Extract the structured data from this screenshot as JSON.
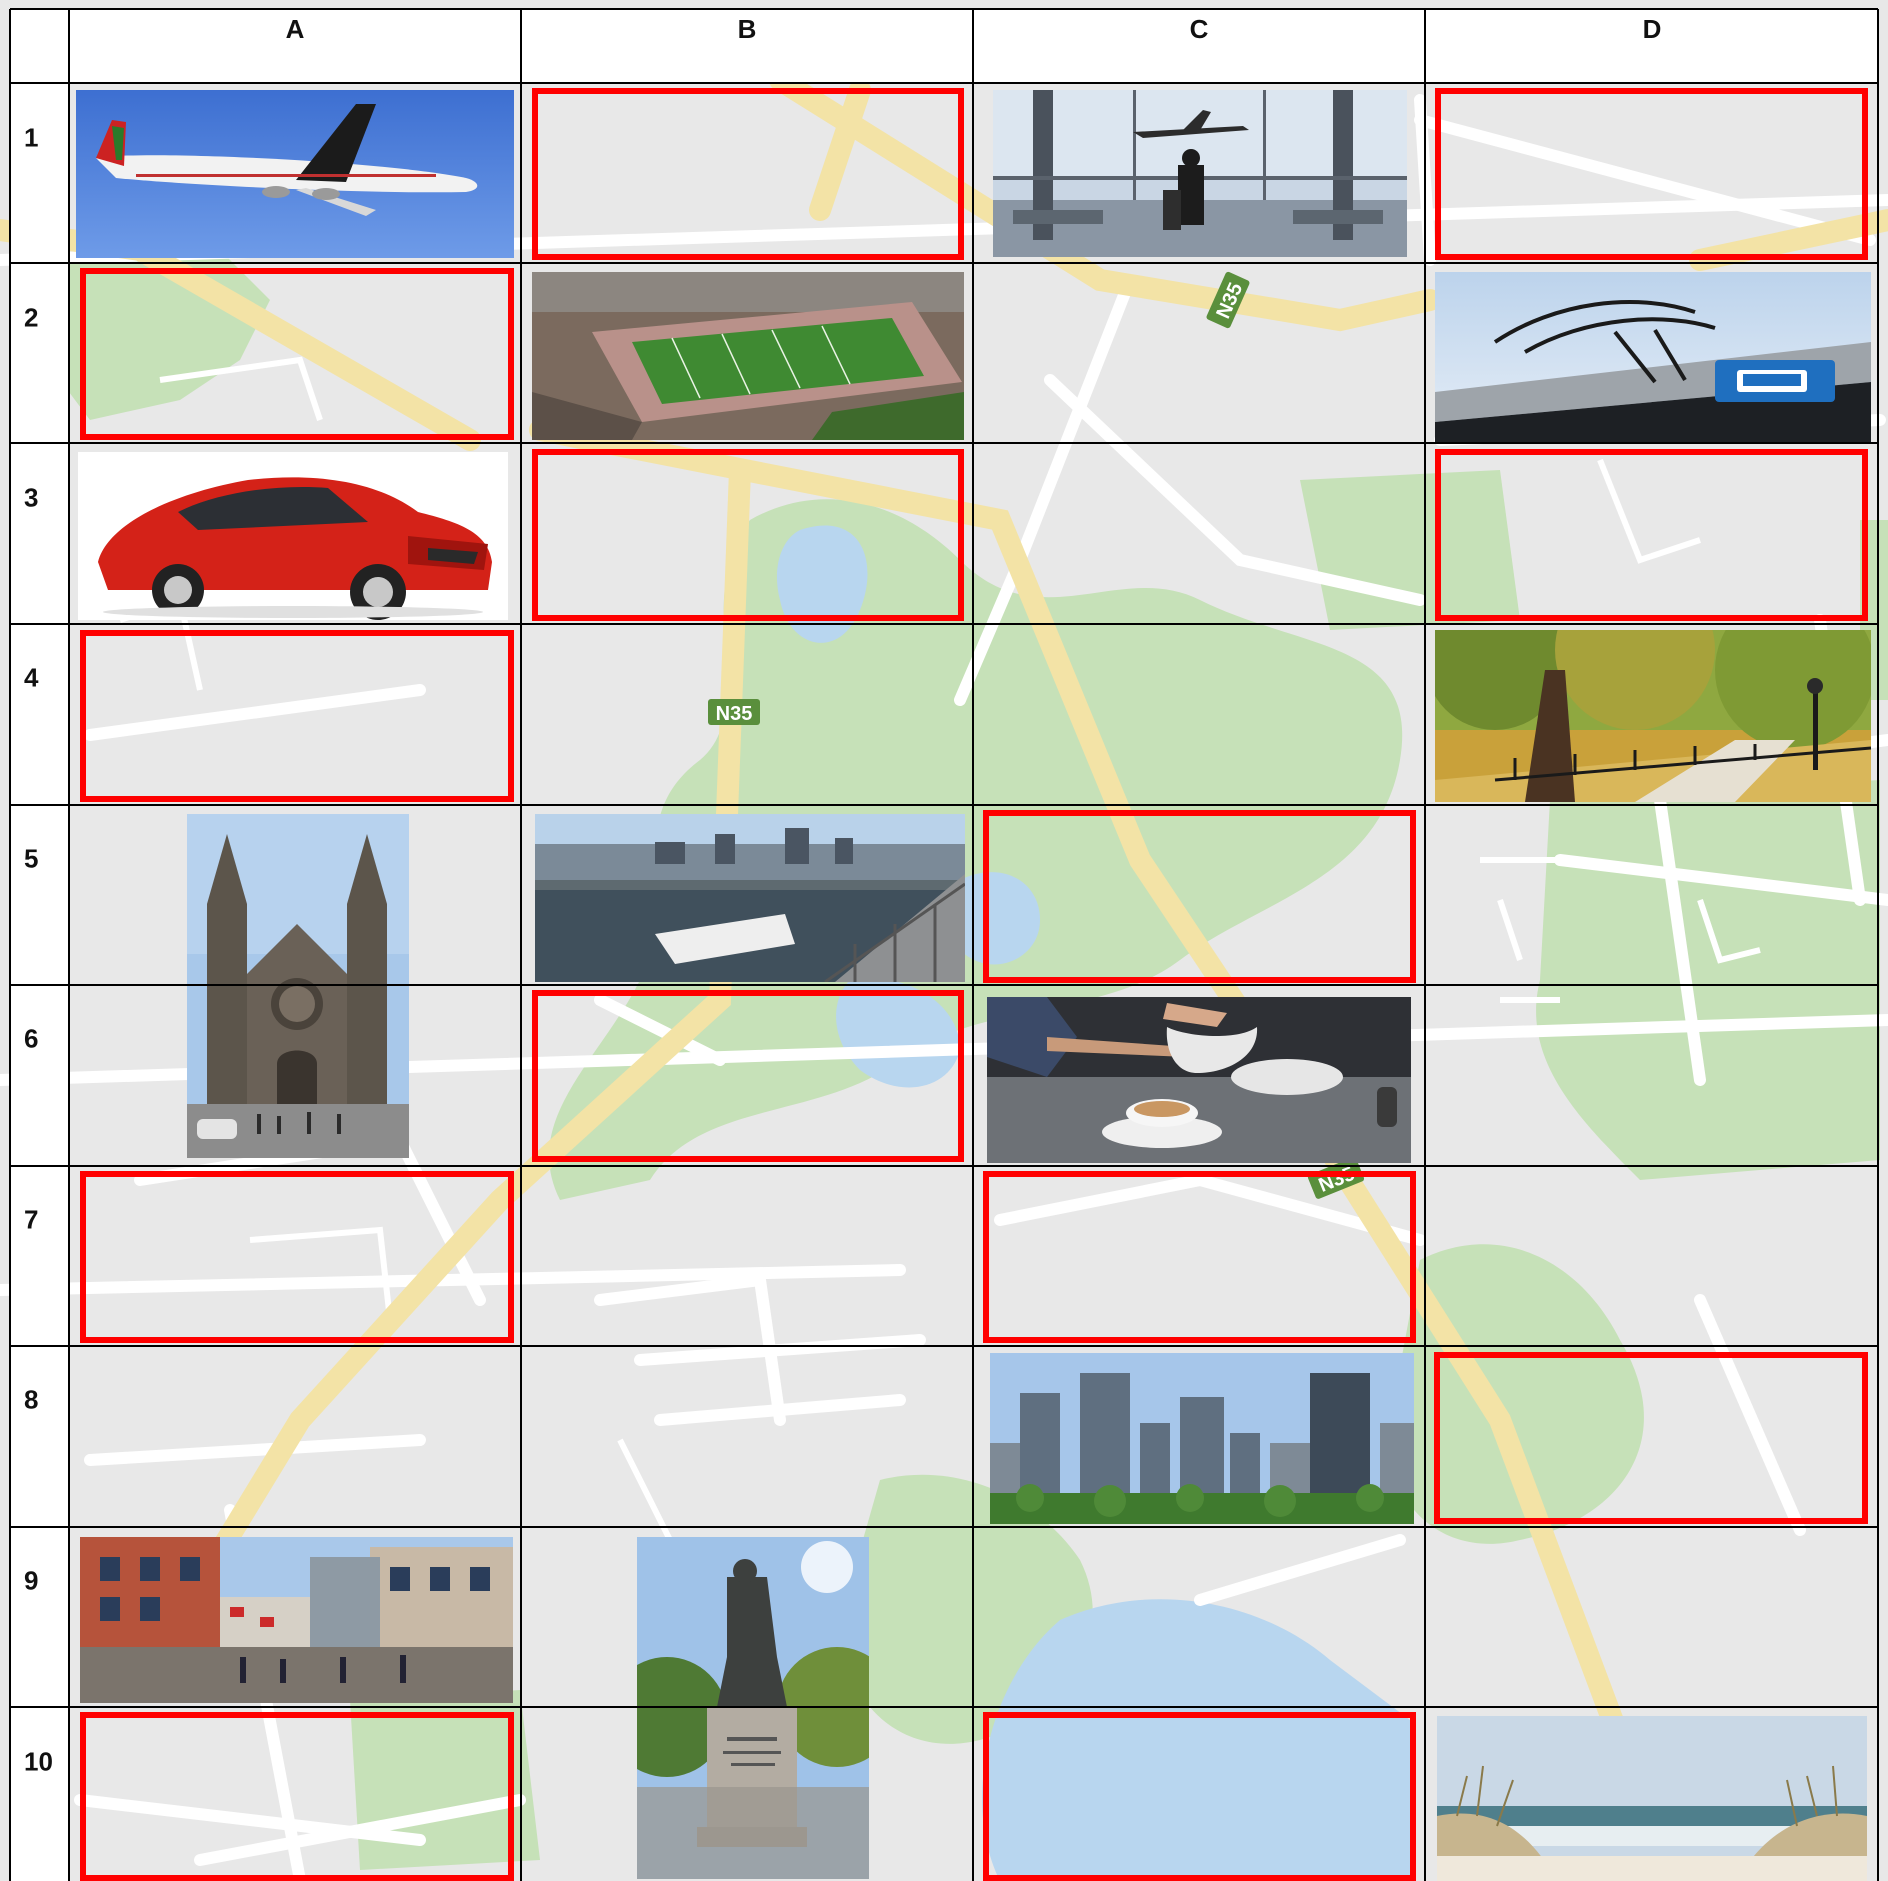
{
  "columns": [
    "A",
    "B",
    "C",
    "D"
  ],
  "rows": [
    "1",
    "2",
    "3",
    "4",
    "5",
    "6",
    "7",
    "8",
    "9",
    "10"
  ],
  "road_labels": [
    "N35",
    "N35",
    "N35"
  ],
  "colors": {
    "map_background": "#e8e8e8",
    "map_roads": "#ffffff",
    "map_highway": "#f3e3a6",
    "map_park": "#c6e1b8",
    "map_water": "#b8d6ef",
    "highway_shield": "#5a8f3c",
    "blank_border": "#ff0000",
    "grid_lines": "#000000"
  },
  "cells": [
    {
      "ref": "A1",
      "content": "photo",
      "icon": "airplane-photo"
    },
    {
      "ref": "B1",
      "content": "blank"
    },
    {
      "ref": "C1",
      "content": "photo",
      "icon": "airport-traveler-photo"
    },
    {
      "ref": "D1",
      "content": "blank"
    },
    {
      "ref": "A2",
      "content": "blank"
    },
    {
      "ref": "B2",
      "content": "photo",
      "icon": "stadium-photo"
    },
    {
      "ref": "C2",
      "content": "empty"
    },
    {
      "ref": "D2",
      "content": "photo",
      "icon": "tram-stop-photo"
    },
    {
      "ref": "A3",
      "content": "photo",
      "icon": "red-car-photo"
    },
    {
      "ref": "B3",
      "content": "blank"
    },
    {
      "ref": "C3",
      "content": "empty"
    },
    {
      "ref": "D3",
      "content": "blank"
    },
    {
      "ref": "A4",
      "content": "blank"
    },
    {
      "ref": "B4",
      "content": "empty"
    },
    {
      "ref": "C4",
      "content": "empty"
    },
    {
      "ref": "D4",
      "content": "photo",
      "icon": "autumn-park-photo"
    },
    {
      "ref": "A5",
      "content": "photo",
      "icon": "cathedral-photo"
    },
    {
      "ref": "B5",
      "content": "photo",
      "icon": "harbour-photo"
    },
    {
      "ref": "C5",
      "content": "blank"
    },
    {
      "ref": "D5",
      "content": "empty"
    },
    {
      "ref": "A6",
      "content": "photo",
      "icon": "cathedral-photo"
    },
    {
      "ref": "B6",
      "content": "blank"
    },
    {
      "ref": "C6",
      "content": "photo",
      "icon": "coffee-photo"
    },
    {
      "ref": "D6",
      "content": "empty"
    },
    {
      "ref": "A7",
      "content": "blank"
    },
    {
      "ref": "B7",
      "content": "empty"
    },
    {
      "ref": "C7",
      "content": "blank"
    },
    {
      "ref": "D7",
      "content": "empty"
    },
    {
      "ref": "A8",
      "content": "empty"
    },
    {
      "ref": "B8",
      "content": "empty"
    },
    {
      "ref": "C8",
      "content": "photo",
      "icon": "city-skyline-photo"
    },
    {
      "ref": "D8",
      "content": "blank"
    },
    {
      "ref": "A9",
      "content": "photo",
      "icon": "old-street-photo"
    },
    {
      "ref": "B9",
      "content": "photo",
      "icon": "statue-photo"
    },
    {
      "ref": "C9",
      "content": "empty"
    },
    {
      "ref": "D9",
      "content": "empty"
    },
    {
      "ref": "A10",
      "content": "blank"
    },
    {
      "ref": "B10",
      "content": "photo",
      "icon": "statue-photo"
    },
    {
      "ref": "C10",
      "content": "blank"
    },
    {
      "ref": "D10",
      "content": "photo",
      "icon": "beach-dunes-photo"
    }
  ]
}
